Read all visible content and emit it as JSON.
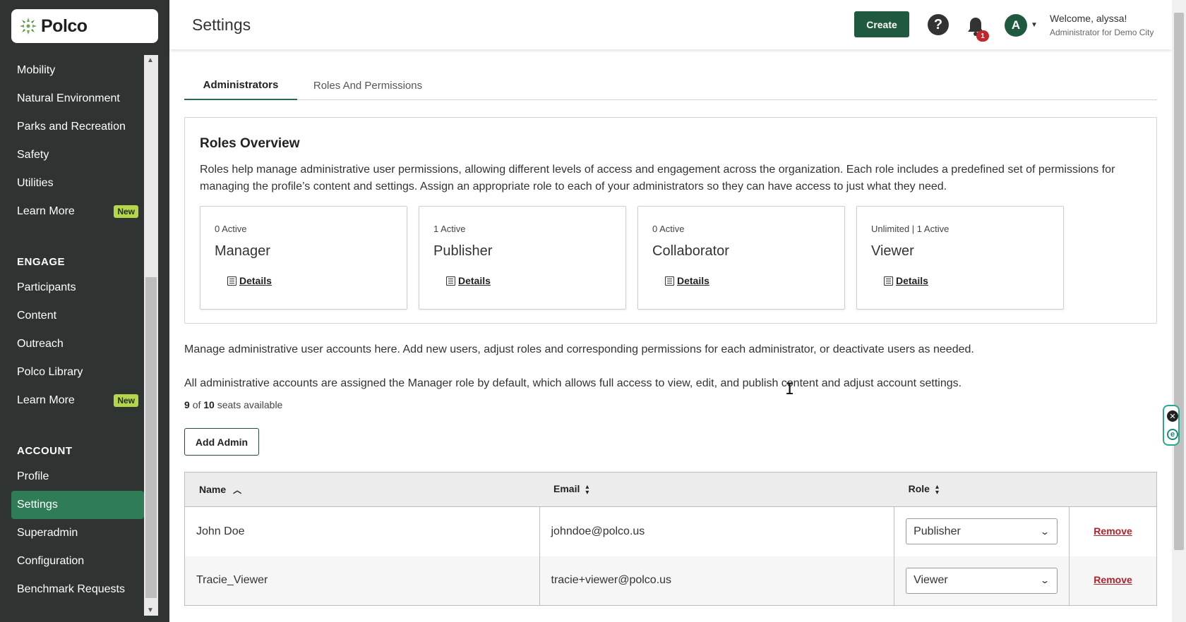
{
  "app": {
    "logo_text": "Polco",
    "page_title": "Settings"
  },
  "sidebar": {
    "items_top": [
      {
        "label": "Mobility"
      },
      {
        "label": "Natural Environment"
      },
      {
        "label": "Parks and Recreation"
      },
      {
        "label": "Safety"
      },
      {
        "label": "Utilities"
      },
      {
        "label": "Learn More",
        "badge": "New"
      }
    ],
    "engage_header": "ENGAGE",
    "engage_items": [
      {
        "label": "Participants"
      },
      {
        "label": "Content"
      },
      {
        "label": "Outreach"
      },
      {
        "label": "Polco Library"
      },
      {
        "label": "Learn More",
        "badge": "New"
      }
    ],
    "account_header": "ACCOUNT",
    "account_items": [
      {
        "label": "Profile"
      },
      {
        "label": "Settings",
        "active": true
      },
      {
        "label": "Superadmin"
      },
      {
        "label": "Configuration"
      },
      {
        "label": "Benchmark Requests"
      }
    ]
  },
  "header": {
    "create_label": "Create",
    "help_glyph": "?",
    "notification_count": "1",
    "avatar_initial": "A",
    "welcome": "Welcome, alyssa!",
    "subtitle": "Administrator for Demo City"
  },
  "tabs": [
    {
      "label": "Administrators",
      "active": true
    },
    {
      "label": "Roles And Permissions"
    }
  ],
  "roles_overview": {
    "title": "Roles Overview",
    "description": "Roles help manage administrative user permissions, allowing different levels of access and engagement across the organization. Each role includes a predefined set of permissions for managing the profile’s content and settings. Assign an appropriate role to each of your administrators so they can have access to just what they need.",
    "roles": [
      {
        "count": "0 Active",
        "name": "Manager",
        "details": "Details"
      },
      {
        "count": "1 Active",
        "name": "Publisher",
        "details": "Details"
      },
      {
        "count": "0 Active",
        "name": "Collaborator",
        "details": "Details"
      },
      {
        "count": "Unlimited | 1 Active",
        "name": "Viewer",
        "details": "Details"
      }
    ]
  },
  "manage_text": "Manage administrative user accounts here. Add new users, adjust roles and corresponding permissions for each administrator, or deactivate users as needed.",
  "default_role_text": "All administrative accounts are assigned the Manager role by default, which allows full access to view, edit, and publish content and adjust account settings.",
  "seats": {
    "used": "9",
    "of_word": "of",
    "total": "10",
    "suffix": "seats available"
  },
  "add_admin_label": "Add Admin",
  "table": {
    "columns": [
      "Name",
      "Email",
      "Role"
    ],
    "rows": [
      {
        "name": "John Doe",
        "email": "johndoe@polco.us",
        "role": "Publisher",
        "action": "Remove"
      },
      {
        "name": "Tracie_Viewer",
        "email": "tracie+viewer@polco.us",
        "role": "Viewer",
        "action": "Remove"
      }
    ]
  },
  "colors": {
    "sidebar_bg": "#2f3332",
    "accent_green": "#1f5a40",
    "active_nav": "#2e7d57",
    "badge_green": "#b5d64a",
    "danger_red": "#b0222a"
  }
}
